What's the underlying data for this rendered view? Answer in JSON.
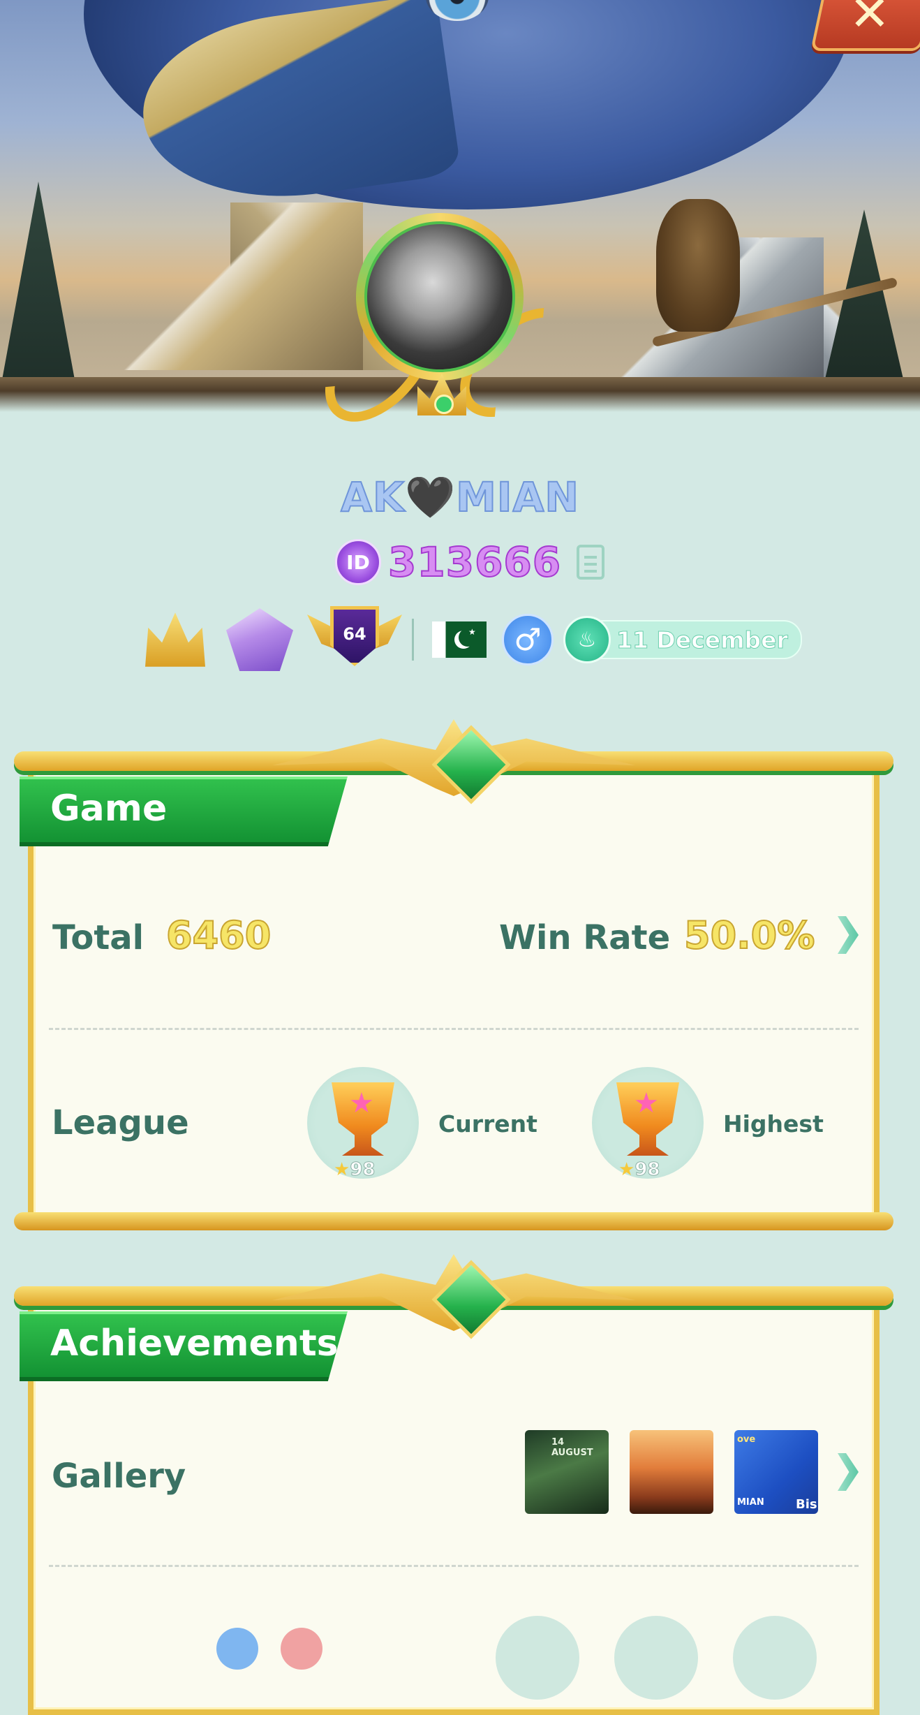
{
  "profile": {
    "username": "AK🖤MIAN",
    "id_label": "ID",
    "id_value": "313666",
    "birthday": "11 December",
    "level": "64",
    "gender_symbol": "♂",
    "country": "Pakistan"
  },
  "game": {
    "title": "Game",
    "total_label": "Total",
    "total_value": "6460",
    "win_rate_label": "Win Rate",
    "win_rate_value": "50.0%",
    "league_label": "League",
    "current_label": "Current",
    "current_level": "98",
    "highest_label": "Highest",
    "highest_level": "98"
  },
  "achievements": {
    "title": "Achievements",
    "gallery_label": "Gallery",
    "gallery": [
      {
        "caption": "14 AUGUST"
      },
      {
        "caption": ""
      },
      {
        "caption_left": "MIAN",
        "caption_right": "Bis",
        "badge": "ove"
      }
    ]
  },
  "colors": {
    "background": "#d3e9e4",
    "label_green": "#3b7264",
    "gold_value": "#f6e567",
    "id_purple": "#d78df2",
    "name_blue": "#a9c6f2",
    "ribbon_green": "#139233",
    "close_red": "#d04a2e"
  },
  "icons": [
    "close-icon",
    "copy-icon",
    "crown-badge-icon",
    "diamond-badge-icon",
    "level-shield-icon",
    "pakistan-flag-icon",
    "male-icon",
    "cake-icon",
    "chevron-right-icon",
    "trophy-icon",
    "star-icon"
  ]
}
